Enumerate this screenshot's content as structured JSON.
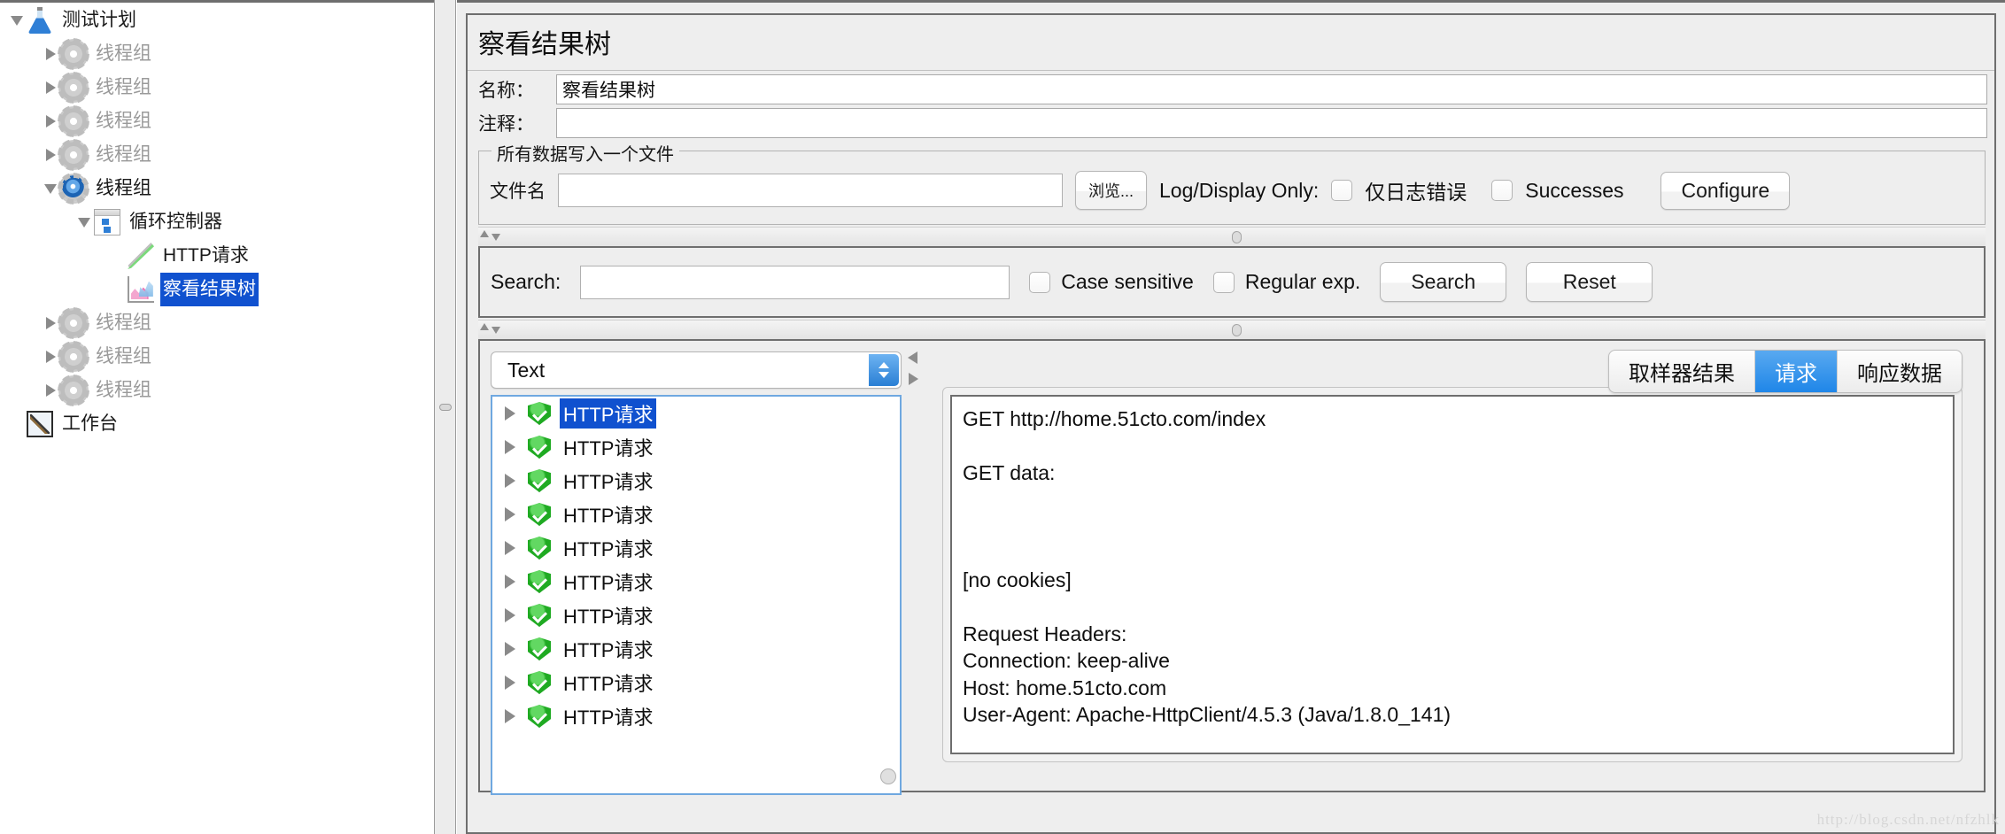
{
  "tree": {
    "items": [
      {
        "label": "测试计划",
        "icon": "flask-icon",
        "depth": 0,
        "toggle": "down",
        "selected": false,
        "muted": false
      },
      {
        "label": "线程组",
        "icon": "gear-icon",
        "depth": 1,
        "toggle": "right",
        "selected": false,
        "muted": true
      },
      {
        "label": "线程组",
        "icon": "gear-icon",
        "depth": 1,
        "toggle": "right",
        "selected": false,
        "muted": true
      },
      {
        "label": "线程组",
        "icon": "gear-icon",
        "depth": 1,
        "toggle": "right",
        "selected": false,
        "muted": true
      },
      {
        "label": "线程组",
        "icon": "gear-icon",
        "depth": 1,
        "toggle": "right",
        "selected": false,
        "muted": true
      },
      {
        "label": "线程组",
        "icon": "gear-active-icon",
        "depth": 1,
        "toggle": "down",
        "selected": false,
        "muted": false
      },
      {
        "label": "循环控制器",
        "icon": "loop-controller-icon",
        "depth": 2,
        "toggle": "down",
        "selected": false,
        "muted": false
      },
      {
        "label": "HTTP请求",
        "icon": "http-request-icon",
        "depth": 3,
        "toggle": "none",
        "selected": false,
        "muted": false
      },
      {
        "label": "察看结果树",
        "icon": "view-results-tree-icon",
        "depth": 3,
        "toggle": "none",
        "selected": true,
        "muted": false
      },
      {
        "label": "线程组",
        "icon": "gear-icon",
        "depth": 1,
        "toggle": "right",
        "selected": false,
        "muted": true
      },
      {
        "label": "线程组",
        "icon": "gear-icon",
        "depth": 1,
        "toggle": "right",
        "selected": false,
        "muted": true
      },
      {
        "label": "线程组",
        "icon": "gear-icon",
        "depth": 1,
        "toggle": "right",
        "selected": false,
        "muted": true
      },
      {
        "label": "工作台",
        "icon": "workbench-icon",
        "depth": 0,
        "toggle": "none",
        "selected": false,
        "muted": false
      }
    ]
  },
  "panel": {
    "title": "察看结果树",
    "name_label": "名称：",
    "name_value": "察看结果树",
    "comment_label": "注释：",
    "comment_value": ""
  },
  "file_group": {
    "title": "所有数据写入一个文件",
    "filename_label": "文件名",
    "filename_value": "",
    "browse_button": "浏览...",
    "log_display_label": "Log/Display Only:",
    "errors_only_label": "仅日志错误",
    "errors_only_checked": false,
    "successes_label": "Successes",
    "successes_checked": false,
    "configure_button": "Configure"
  },
  "search": {
    "label": "Search:",
    "value": "",
    "case_sensitive_label": "Case sensitive",
    "case_sensitive_checked": false,
    "regular_exp_label": "Regular exp.",
    "regular_exp_checked": false,
    "search_button": "Search",
    "reset_button": "Reset"
  },
  "render": {
    "selected_renderer": "Text"
  },
  "results": {
    "rows": [
      {
        "label": "HTTP请求",
        "status": "success",
        "selected": true
      },
      {
        "label": "HTTP请求",
        "status": "success",
        "selected": false
      },
      {
        "label": "HTTP请求",
        "status": "success",
        "selected": false
      },
      {
        "label": "HTTP请求",
        "status": "success",
        "selected": false
      },
      {
        "label": "HTTP请求",
        "status": "success",
        "selected": false
      },
      {
        "label": "HTTP请求",
        "status": "success",
        "selected": false
      },
      {
        "label": "HTTP请求",
        "status": "success",
        "selected": false
      },
      {
        "label": "HTTP请求",
        "status": "success",
        "selected": false
      },
      {
        "label": "HTTP请求",
        "status": "success",
        "selected": false
      },
      {
        "label": "HTTP请求",
        "status": "success",
        "selected": false
      }
    ]
  },
  "detail": {
    "tabs": [
      {
        "label": "取样器结果",
        "active": false
      },
      {
        "label": "请求",
        "active": true
      },
      {
        "label": "响应数据",
        "active": false
      }
    ],
    "content": "GET http://home.51cto.com/index\n\nGET data:\n\n\n\n[no cookies]\n\nRequest Headers:\nConnection: keep-alive\nHost: home.51cto.com\nUser-Agent: Apache-HttpClient/4.5.3 (Java/1.8.0_141)"
  },
  "watermark": "http://blog.csdn.net/nfzhlk",
  "colors": {
    "selection_blue": "#1051cf",
    "tab_active_blue": "#1f86e8",
    "success_green": "#1faa22",
    "panel_bg": "#eeeeee"
  }
}
